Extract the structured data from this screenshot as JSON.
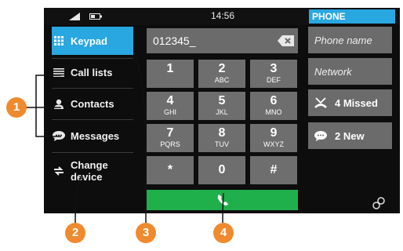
{
  "status": {
    "time": "14:56",
    "title": "PHONE"
  },
  "sidebar": {
    "items": [
      {
        "label": "Keypad",
        "icon": "keypad-icon"
      },
      {
        "label": "Call lists",
        "icon": "list-icon"
      },
      {
        "label": "Contacts",
        "icon": "person-icon"
      },
      {
        "label": "Messages",
        "icon": "message-icon"
      },
      {
        "label": "Change",
        "label2": "device",
        "icon": "swap-icon"
      }
    ]
  },
  "dialer": {
    "number": "012345_",
    "keys": [
      {
        "digit": "1",
        "letters": ""
      },
      {
        "digit": "2",
        "letters": "ABC"
      },
      {
        "digit": "3",
        "letters": "DEF"
      },
      {
        "digit": "4",
        "letters": "GHI"
      },
      {
        "digit": "5",
        "letters": "JKL"
      },
      {
        "digit": "6",
        "letters": "MNO"
      },
      {
        "digit": "7",
        "letters": "PQRS"
      },
      {
        "digit": "8",
        "letters": "TUV"
      },
      {
        "digit": "9",
        "letters": "WXYZ"
      },
      {
        "digit": "*",
        "letters": ""
      },
      {
        "digit": "0",
        "letters": ""
      },
      {
        "digit": "#",
        "letters": ""
      }
    ]
  },
  "right_panel": {
    "phone_name": "Phone name",
    "network": "Network",
    "missed": "4 Missed",
    "new_messages": "2 New"
  },
  "callouts": [
    "1",
    "2",
    "3",
    "4"
  ],
  "colors": {
    "accent": "#29a7e0",
    "call": "#1faf4b",
    "callout": "#f08a2e",
    "key": "#6e6e6e"
  }
}
